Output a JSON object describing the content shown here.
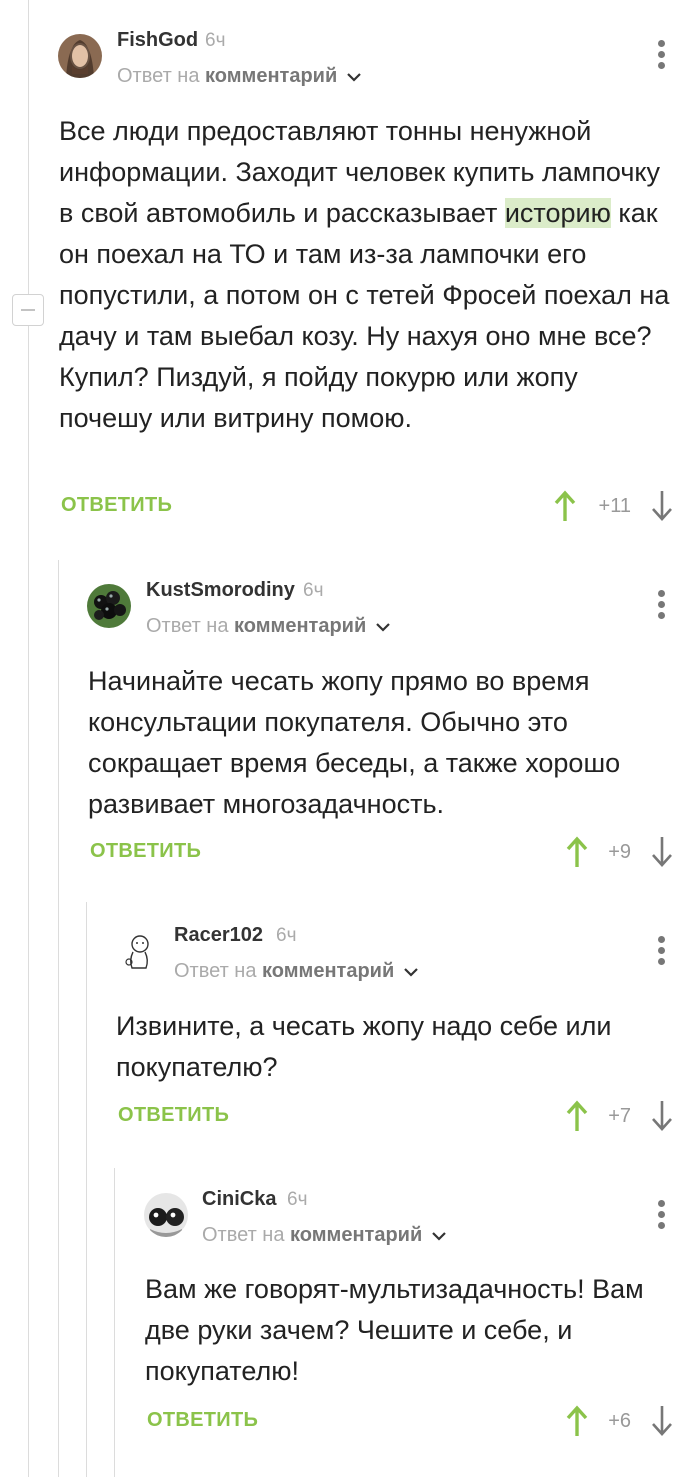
{
  "comments": [
    {
      "author": "FishGod",
      "time": "6ч",
      "reply_prefix": "Ответ на",
      "reply_target": "комментарий",
      "text_before": "Все люди предоставляют тонны ненужной информации. Заходит человек купить лампочку в свой автомобиль и рассказывает ",
      "highlight": "историю",
      "text_after": " как он поехал на ТО и там из-за лампочки его попустили, а потом он с тетей Фросей поехал на дачу и там выебал козу. Ну нахуя оно мне все? Купил? Пиздуй, я пойду покурю или жопу почешу или витрину помою.",
      "reply_label": "ОТВЕТИТЬ",
      "score": "+11"
    },
    {
      "author": "KustSmorodiny",
      "time": "6ч",
      "reply_prefix": "Ответ на",
      "reply_target": "комментарий",
      "text": "Начинайте чесать жопу прямо во время консультации покупателя. Обычно это сокращает время беседы, а также хорошо развивает многозадачность.",
      "reply_label": "ОТВЕТИТЬ",
      "score": "+9"
    },
    {
      "author": "Racer102",
      "time": "6ч",
      "reply_prefix": "Ответ на",
      "reply_target": "комментарий",
      "text": "Извините, а чесать жопу надо себе или покупателю?",
      "reply_label": "ОТВЕТИТЬ",
      "score": "+7"
    },
    {
      "author": "CiniCka",
      "time": "6ч",
      "reply_prefix": "Ответ на",
      "reply_target": "комментарий",
      "text": "Вам же говорят-мультизадачность! Вам две руки зачем? Чешите и себе, и покупателю!",
      "reply_label": "ОТВЕТИТЬ",
      "score": "+6"
    }
  ],
  "colors": {
    "accent_green": "#8bc34a",
    "highlight": "#dbecc9",
    "muted": "#aaaaaa",
    "thread_line": "#dcdcdc"
  },
  "icons": [
    "collapse-icon",
    "more-vert-icon",
    "chevron-down-icon",
    "arrow-up-icon",
    "arrow-down-icon"
  ]
}
